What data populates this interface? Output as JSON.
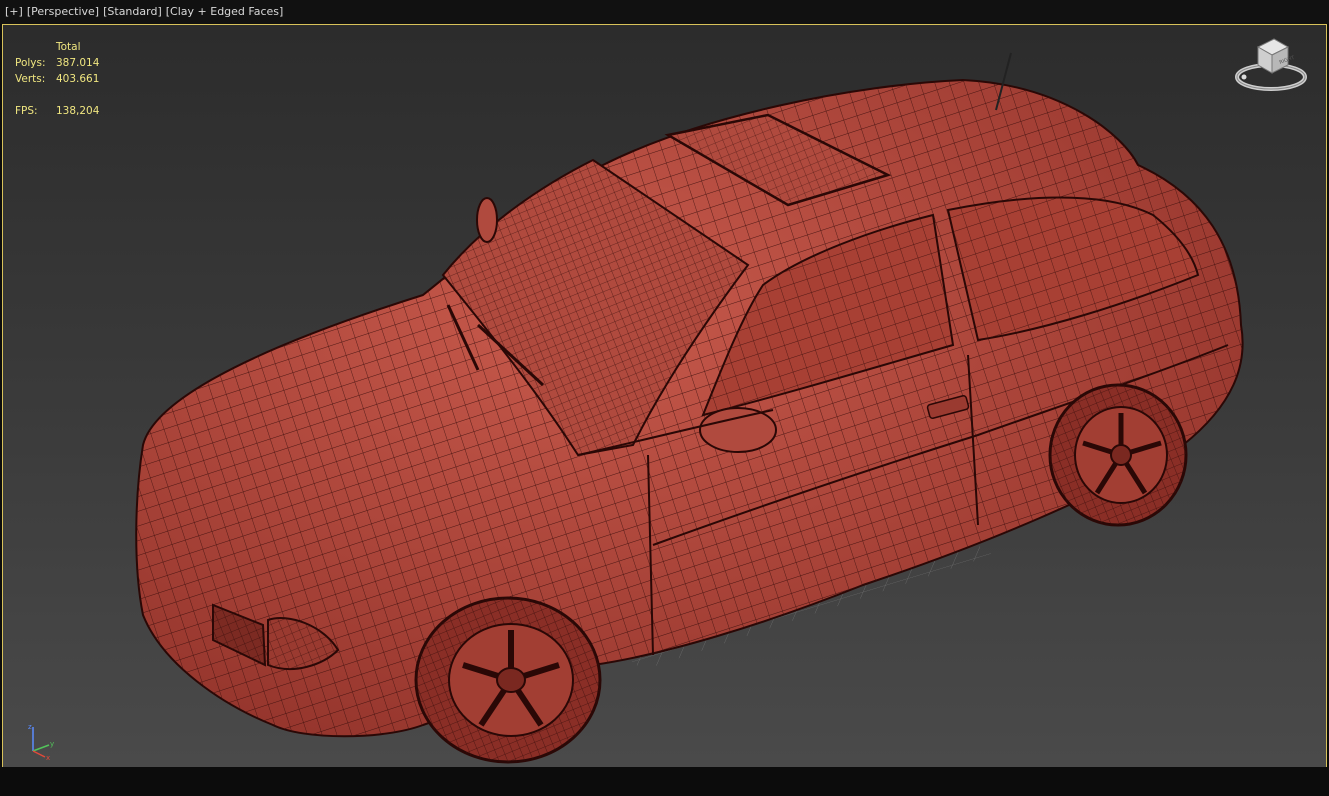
{
  "viewport": {
    "label_plus": "[+]",
    "label_view": "[Perspective]",
    "label_shading_std": "[Standard]",
    "label_shading": "[Clay + Edged Faces]"
  },
  "stats": {
    "header": "Total",
    "polys_label": "Polys:",
    "polys_value": "387.014",
    "verts_label": "Verts:",
    "verts_value": "403.661",
    "fps_label": "FPS:",
    "fps_value": "138,204"
  },
  "viewcube": {
    "face_label": "RIGHT"
  },
  "colors": {
    "viewport_border": "#d8c25a",
    "stats_text": "#f0e680",
    "clay": "#b8483c",
    "wire": "#3a0e0c"
  },
  "icons": [
    "viewcube-icon",
    "axis-tripod-icon"
  ],
  "model": {
    "description_name": "car-model"
  }
}
